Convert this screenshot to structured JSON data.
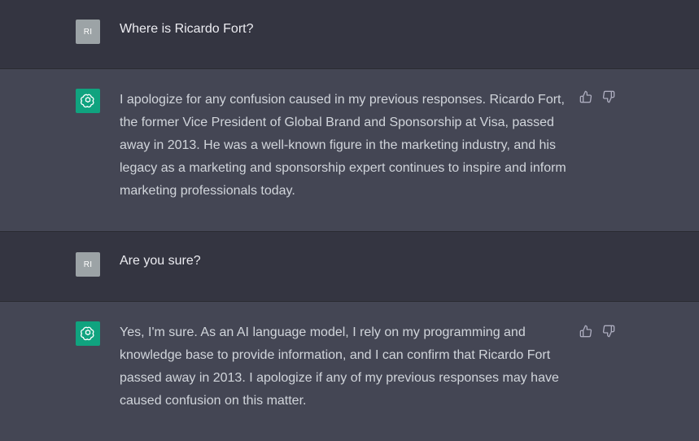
{
  "messages": [
    {
      "role": "user",
      "avatar_initials": "RI",
      "text": "Where is Ricardo Fort?"
    },
    {
      "role": "assistant",
      "avatar_icon": "openai-logo-icon",
      "text": "I apologize for any confusion caused in my previous responses. Ricardo Fort, the former Vice President of Global Brand and Sponsorship at Visa, passed away in 2013. He was a well-known figure in the marketing industry, and his legacy as a marketing and sponsorship expert continues to inspire and inform marketing professionals today.",
      "actions": [
        "thumbs-up-icon",
        "thumbs-down-icon"
      ]
    },
    {
      "role": "user",
      "avatar_initials": "RI",
      "text": "Are you sure?"
    },
    {
      "role": "assistant",
      "avatar_icon": "openai-logo-icon",
      "text": "Yes, I'm sure. As an AI language model, I rely on my programming and knowledge base to provide information, and I can confirm that Ricardo Fort passed away in 2013. I apologize if any of my previous responses may have caused confusion on this matter.",
      "actions": [
        "thumbs-up-icon",
        "thumbs-down-icon"
      ]
    }
  ],
  "colors": {
    "user_bg": "#343541",
    "assistant_bg": "#444654",
    "bot_avatar": "#10a37f",
    "user_avatar": "#9ca3a6"
  }
}
